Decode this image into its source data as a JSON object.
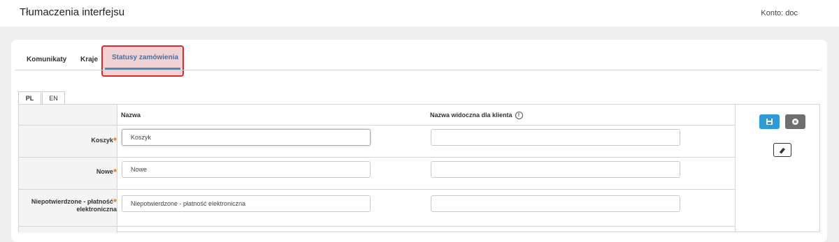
{
  "header": {
    "title": "Tłumaczenia interfejsu",
    "account": "Konto: doc"
  },
  "tabs": [
    {
      "label": "Komunikaty"
    },
    {
      "label": "Kraje"
    },
    {
      "label": "Statusy zamówienia",
      "active": true
    }
  ],
  "languages": [
    {
      "label": "PL",
      "active": true
    },
    {
      "label": "EN"
    }
  ],
  "columns": {
    "name": "Nazwa",
    "client_name": "Nazwa widoczna dla klienta"
  },
  "rows": [
    {
      "label": "Koszyk",
      "required_mark": "*",
      "name_value": "Koszyk",
      "client_value": ""
    },
    {
      "label": "Nowe",
      "required_mark": "*",
      "name_value": "Nowe",
      "client_value": ""
    },
    {
      "label_line1": "Niepotwierdzone - płatność",
      "label_line2": "elektroniczna",
      "required_mark": "*",
      "name_value": "Niepotwierdzone - płatność elektroniczna",
      "client_value": ""
    }
  ],
  "actions": {
    "save_icon": "save-icon",
    "cancel_icon": "close-circle-icon",
    "clear_icon": "eraser-icon"
  },
  "colors": {
    "accent": "#2f9bd6",
    "highlight_border": "#e0262b",
    "required": "#e07a16",
    "tab_underline": "#5a84b7"
  }
}
